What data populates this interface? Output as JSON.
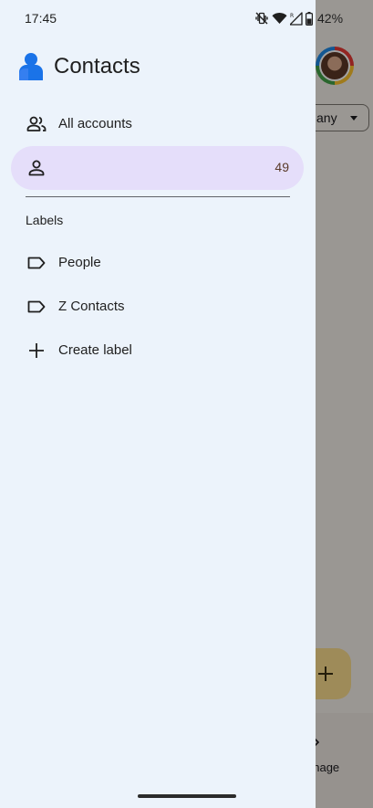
{
  "status_bar": {
    "time": "17:45",
    "battery": "42%",
    "icons": [
      "vibrate-off-icon",
      "wifi-icon",
      "signal-icon",
      "battery-icon"
    ]
  },
  "drawer": {
    "app_title": "Contacts",
    "items": [
      {
        "label": "All accounts",
        "icon": "people-icon"
      },
      {
        "label": "",
        "count": "49",
        "icon": "person-icon",
        "selected": true
      }
    ],
    "labels_heading": "Labels",
    "labels": [
      {
        "label": "People",
        "icon": "label-icon"
      },
      {
        "label": "Z Contacts",
        "icon": "label-icon"
      }
    ],
    "create_label": "Create label"
  },
  "background": {
    "filter_chip": "any",
    "manage_label": "anage"
  },
  "colors": {
    "drawer_bg": "#ecf3fb",
    "selected_bg": "#e5defa",
    "logo_blue": "#1a73e8",
    "fab_bg": "#f7d98c"
  }
}
